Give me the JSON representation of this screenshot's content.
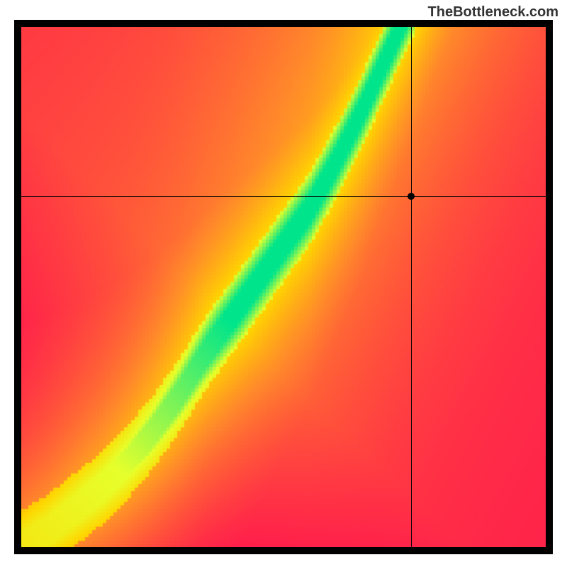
{
  "watermark": "TheBottleneck.com",
  "chart_data": {
    "type": "heatmap",
    "title": "",
    "xlabel": "",
    "ylabel": "",
    "xlim": [
      0,
      1
    ],
    "ylim": [
      0,
      1
    ],
    "crosshair": {
      "x": 0.743,
      "y": 0.675
    },
    "marker": {
      "x": 0.743,
      "y": 0.675
    },
    "optimal_curve": [
      {
        "x": 0.0,
        "y": 0.0
      },
      {
        "x": 0.05,
        "y": 0.03
      },
      {
        "x": 0.1,
        "y": 0.07
      },
      {
        "x": 0.15,
        "y": 0.11
      },
      {
        "x": 0.2,
        "y": 0.16
      },
      {
        "x": 0.25,
        "y": 0.22
      },
      {
        "x": 0.3,
        "y": 0.29
      },
      {
        "x": 0.35,
        "y": 0.37
      },
      {
        "x": 0.4,
        "y": 0.44
      },
      {
        "x": 0.45,
        "y": 0.51
      },
      {
        "x": 0.5,
        "y": 0.58
      },
      {
        "x": 0.55,
        "y": 0.65
      },
      {
        "x": 0.6,
        "y": 0.74
      },
      {
        "x": 0.65,
        "y": 0.84
      },
      {
        "x": 0.7,
        "y": 0.95
      }
    ],
    "optimal_band_width": 0.07,
    "colorscale": [
      {
        "stop": 0.0,
        "color": "#FF1E4B"
      },
      {
        "stop": 0.35,
        "color": "#FF8A2A"
      },
      {
        "stop": 0.6,
        "color": "#FFD500"
      },
      {
        "stop": 0.82,
        "color": "#E6FF2B"
      },
      {
        "stop": 1.0,
        "color": "#00E58B"
      }
    ],
    "corner_colors": {
      "top_left": "#FF1E4B",
      "top_right": "#FFD400",
      "bottom_left": "#FF1E4B",
      "bottom_right": "#FF1E4B"
    }
  }
}
